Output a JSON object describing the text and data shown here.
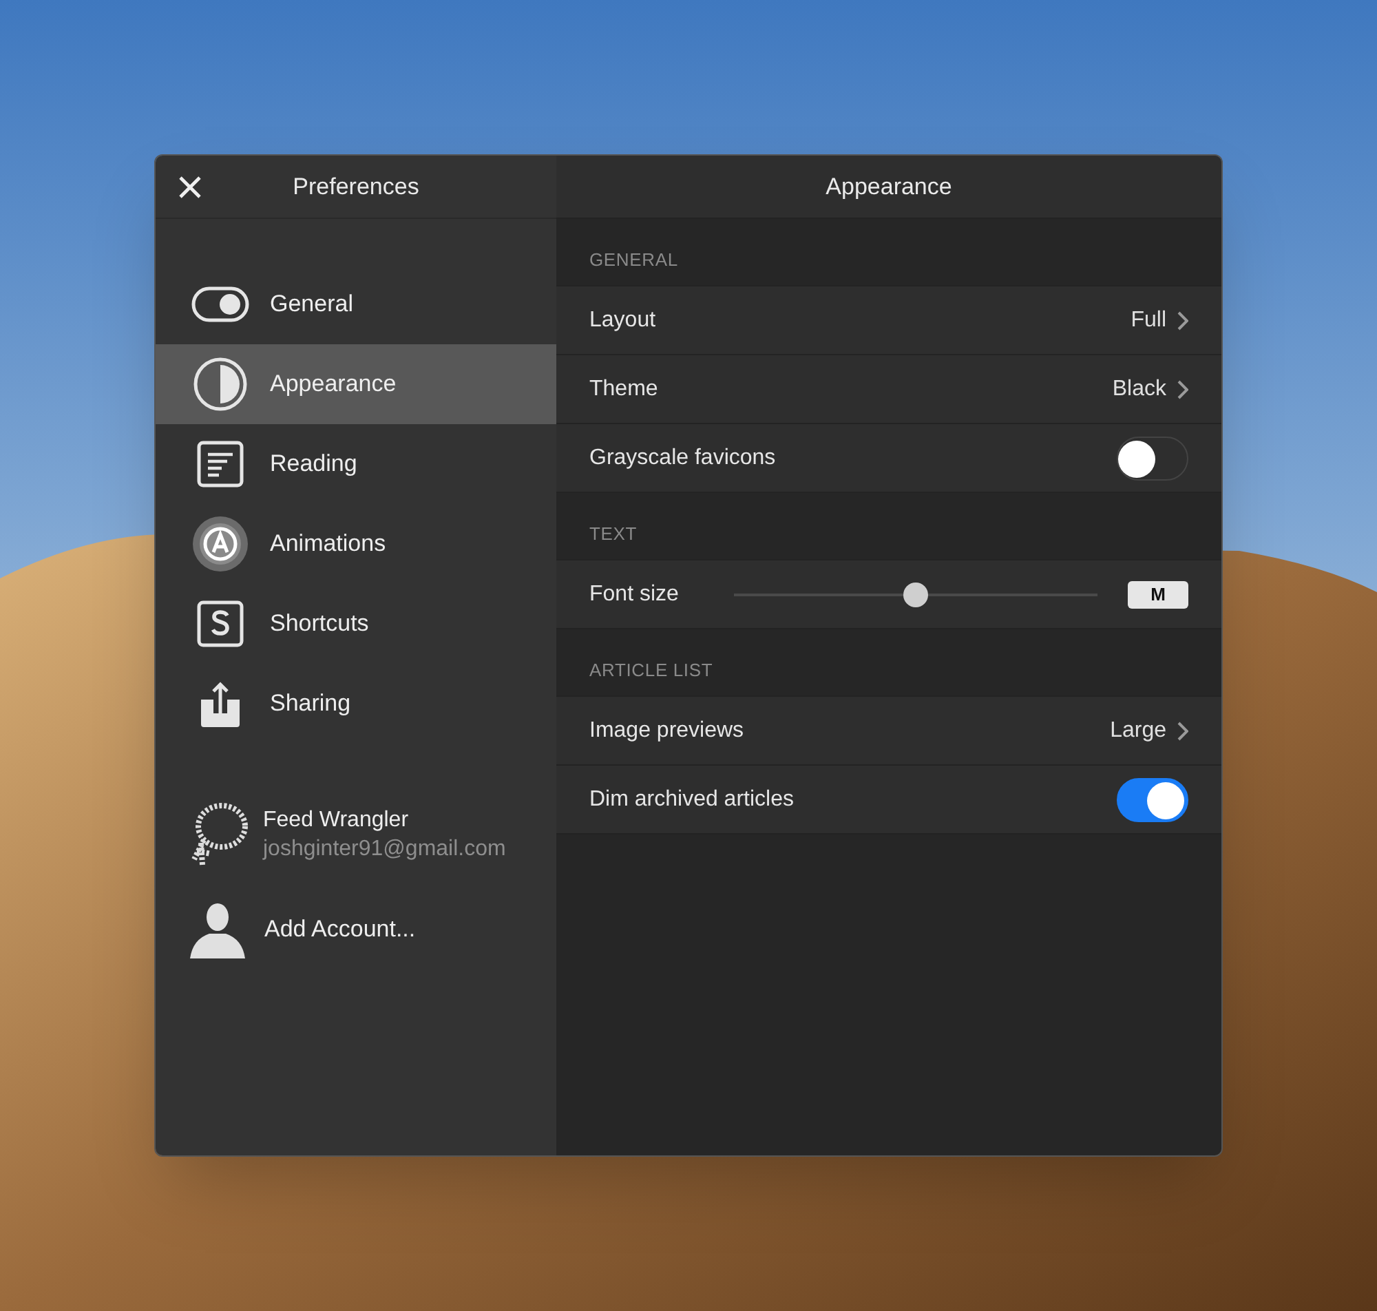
{
  "sidebar": {
    "title": "Preferences",
    "items": [
      {
        "label": "General",
        "selected": false
      },
      {
        "label": "Appearance",
        "selected": true
      },
      {
        "label": "Reading",
        "selected": false
      },
      {
        "label": "Animations",
        "selected": false
      },
      {
        "label": "Shortcuts",
        "selected": false
      },
      {
        "label": "Sharing",
        "selected": false
      }
    ],
    "account": {
      "name": "Feed Wrangler",
      "email": "joshginter91@gmail.com"
    },
    "add_account": "Add Account..."
  },
  "panel": {
    "title": "Appearance",
    "sections": [
      {
        "heading": "GENERAL",
        "rows": [
          {
            "kind": "disclosure",
            "label": "Layout",
            "value": "Full"
          },
          {
            "kind": "disclosure",
            "label": "Theme",
            "value": "Black"
          },
          {
            "kind": "toggle",
            "label": "Grayscale favicons",
            "on": false
          }
        ]
      },
      {
        "heading": "TEXT",
        "rows": [
          {
            "kind": "slider",
            "label": "Font size",
            "level": 0.5,
            "badge": "M"
          }
        ]
      },
      {
        "heading": "ARTICLE LIST",
        "rows": [
          {
            "kind": "disclosure",
            "label": "Image previews",
            "value": "Large"
          },
          {
            "kind": "toggle",
            "label": "Dim archived articles",
            "on": true
          }
        ]
      }
    ]
  }
}
